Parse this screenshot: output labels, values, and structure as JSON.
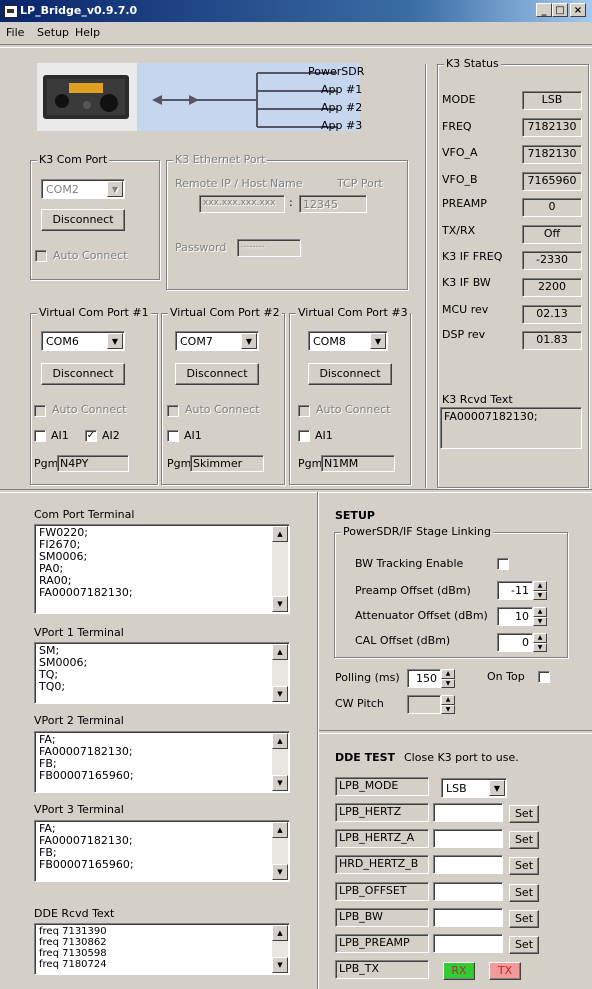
{
  "window": {
    "title": "LP_Bridge_v0.9.7.0",
    "min": "_",
    "max": "□",
    "close": "×"
  },
  "menu": [
    "File",
    "Setup",
    "Help"
  ],
  "diagram": {
    "apps": [
      "PowerSDR",
      "App #1",
      "App #2",
      "App #3"
    ]
  },
  "k3_com": {
    "title": "K3 Com Port",
    "port": "COM2",
    "disconnect": "Disconnect",
    "auto_connect": "Auto Connect"
  },
  "k3_eth": {
    "title": "K3 Ethernet Port",
    "ip_label": "Remote IP / Host Name",
    "port_label": "TCP Port",
    "ip_value": "xxx.xxx.xxx.xxx",
    "port_value": "12345",
    "colon": ":",
    "password_label": "Password",
    "password_value": "--------"
  },
  "vports": [
    {
      "title": "Virtual Com Port #1",
      "port": "COM6",
      "disconnect": "Disconnect",
      "auto_connect": "Auto Connect",
      "ai1": "AI1",
      "ai2": "AI2",
      "pgm_label": "Pgm",
      "pgm": "N4PY"
    },
    {
      "title": "Virtual Com Port #2",
      "port": "COM7",
      "disconnect": "Disconnect",
      "auto_connect": "Auto Connect",
      "ai1": "AI1",
      "pgm_label": "Pgm",
      "pgm": "Skimmer"
    },
    {
      "title": "Virtual Com Port #3",
      "port": "COM8",
      "disconnect": "Disconnect",
      "auto_connect": "Auto Connect",
      "ai1": "AI1",
      "pgm_label": "Pgm",
      "pgm": "N1MM"
    }
  ],
  "k3_status": {
    "title": "K3 Status",
    "rows": [
      {
        "label": "MODE",
        "value": "LSB"
      },
      {
        "label": "FREQ",
        "value": "7182130"
      },
      {
        "label": "VFO_A",
        "value": "7182130"
      },
      {
        "label": "VFO_B",
        "value": "7165960"
      },
      {
        "label": "PREAMP",
        "value": "0"
      },
      {
        "label": "TX/RX",
        "value": "Off"
      },
      {
        "label": "K3 IF FREQ",
        "value": "-2330"
      },
      {
        "label": "K3 IF BW",
        "value": "2200"
      },
      {
        "label": "MCU rev",
        "value": "02.13"
      },
      {
        "label": "DSP rev",
        "value": "01.83"
      }
    ],
    "rcvd_label": "K3 Rcvd Text",
    "rcvd_value": "FA00007182130;"
  },
  "terminals": [
    {
      "title": "Com Port Terminal",
      "lines": [
        "FW0220;",
        "FI2670;",
        "SM0006;",
        "PA0;",
        "RA00;",
        "FA00007182130;"
      ]
    },
    {
      "title": "VPort 1 Terminal",
      "lines": [
        "SM;",
        "SM0006;",
        "TQ;",
        "TQ0;"
      ]
    },
    {
      "title": "VPort 2 Terminal",
      "lines": [
        "FA;",
        "FA00007182130;",
        "FB;",
        "FB00007165960;"
      ]
    },
    {
      "title": "VPort 3 Terminal",
      "lines": [
        "FA;",
        "FA00007182130;",
        "FB;",
        "FB00007165960;"
      ]
    },
    {
      "title": "DDE Rcvd Text",
      "lines": [
        "freq 7131390",
        "freq 7130862",
        "freq 7130598",
        "freq 7180724"
      ]
    }
  ],
  "setup": {
    "title": "SETUP",
    "linking_title": "PowerSDR/IF Stage  Linking",
    "bw_tracking": "BW Tracking Enable",
    "preamp_offset": {
      "label": "Preamp Offset (dBm)",
      "value": "-11"
    },
    "atten_offset": {
      "label": "Attenuator Offset (dBm)",
      "value": "10"
    },
    "cal_offset": {
      "label": "CAL Offset (dBm)",
      "value": "0"
    },
    "polling": {
      "label": "Polling (ms)",
      "value": "150"
    },
    "on_top": "On Top",
    "cw_pitch": "CW Pitch"
  },
  "dde": {
    "title": "DDE TEST",
    "note": "Close K3 port to use.",
    "mode_label": "LPB_MODE",
    "mode_value": "LSB",
    "rows": [
      "LPB_HERTZ",
      "LPB_HERTZ_A",
      "HRD_HERTZ_B",
      "LPB_OFFSET",
      "LPB_BW",
      "LPB_PREAMP"
    ],
    "set": "Set",
    "tx_label": "LPB_TX",
    "rx_btn": "RX",
    "tx_btn": "TX"
  }
}
